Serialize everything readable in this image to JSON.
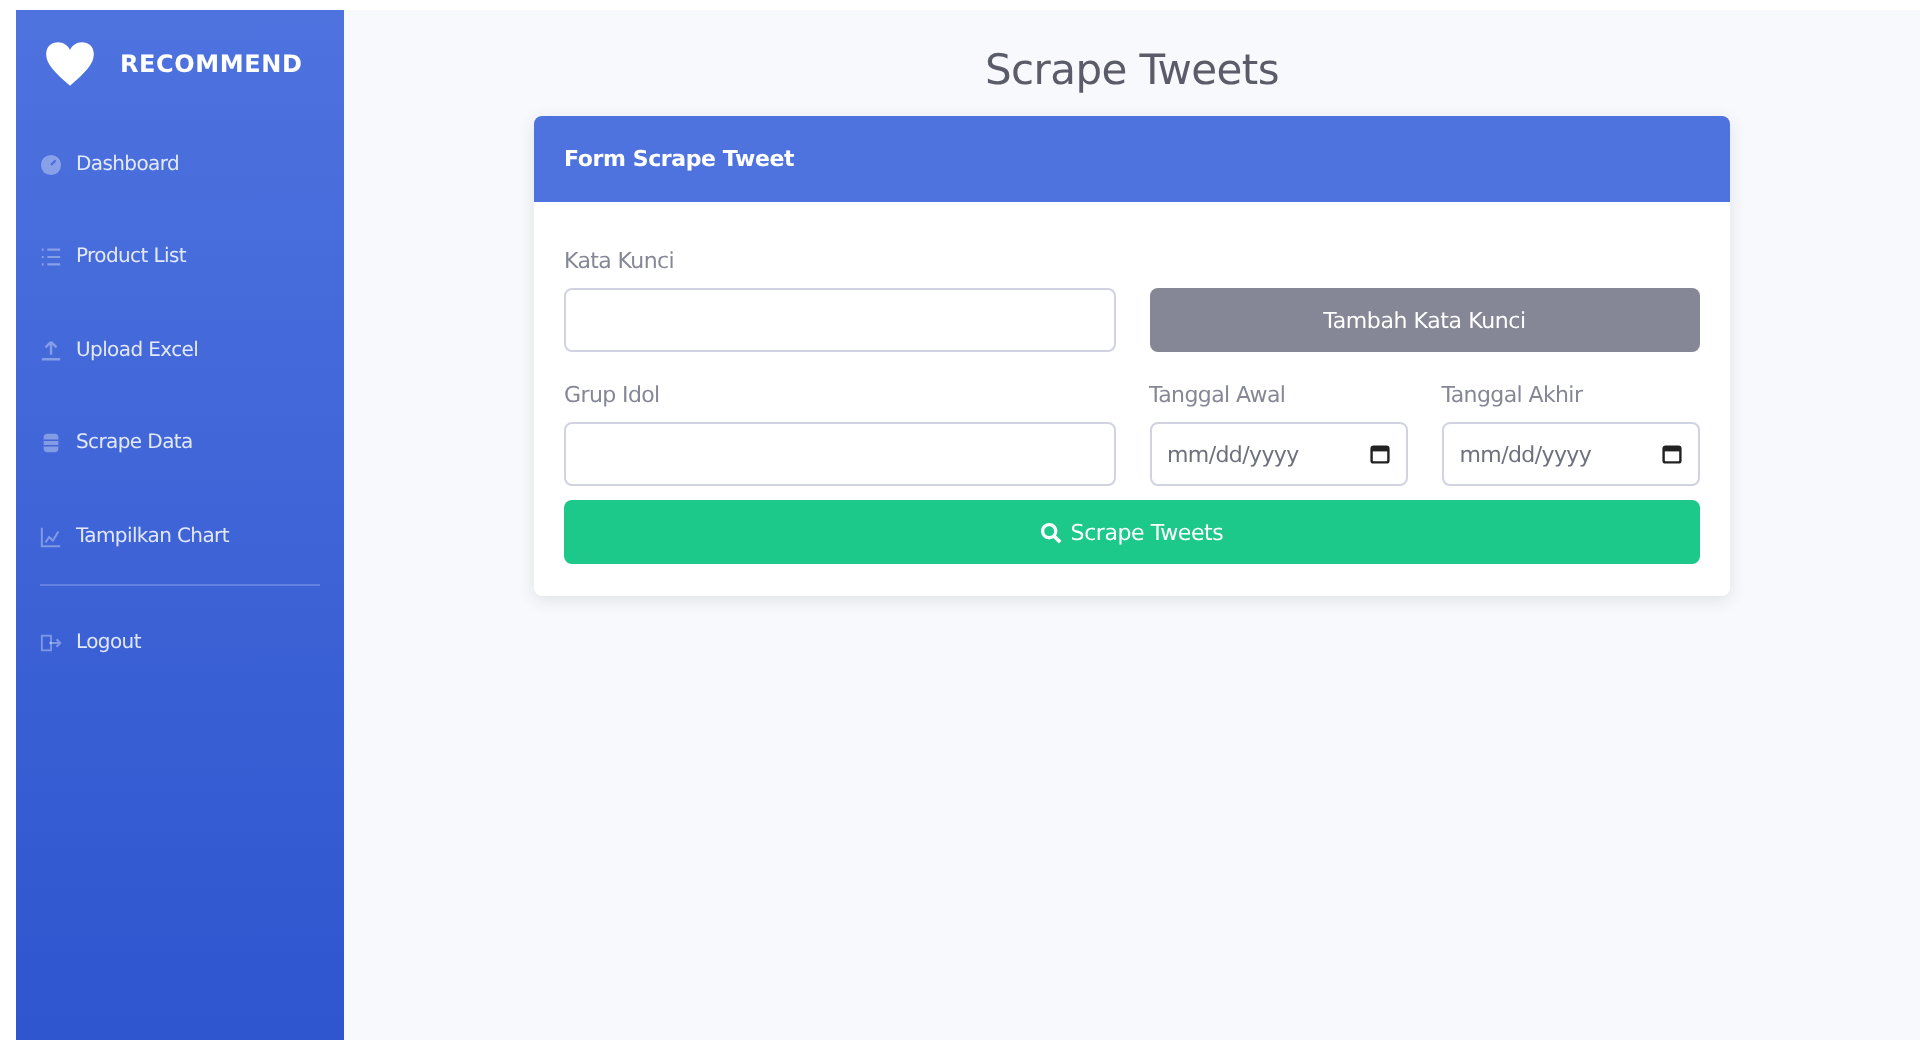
{
  "sidebar": {
    "brand": "RECOMMEND",
    "items": [
      {
        "label": "Dashboard"
      },
      {
        "label": "Product List"
      },
      {
        "label": "Upload Excel"
      },
      {
        "label": "Scrape Data"
      },
      {
        "label": "Tampilkan Chart"
      }
    ],
    "footer_items": [
      {
        "label": "Logout"
      }
    ]
  },
  "page_title": "Scrape Tweets",
  "card": {
    "title": "Form Scrape Tweet",
    "keyword": {
      "label": "Kata Kunci",
      "button": "Tambah Kata Kunci"
    },
    "group": {
      "label": "Grup Idol"
    },
    "start_date": {
      "label": "Tanggal Awal",
      "placeholder": "mm/dd/yyyy"
    },
    "end_date": {
      "label": "Tanggal Akhir",
      "placeholder": "mm/dd/yyyy"
    },
    "submit": "Scrape Tweets"
  }
}
